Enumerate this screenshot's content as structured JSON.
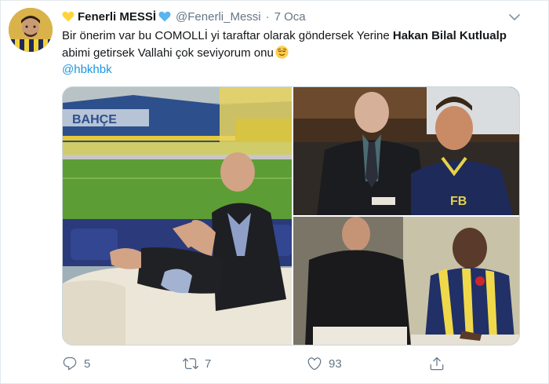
{
  "tweet": {
    "display_name": "Fenerli MESSİ",
    "handle": "@Fenerli_Messi",
    "separator": "·",
    "time": "7 Oca",
    "text_part1": "Bir önerim var bu COMOLLİ yi taraftar olarak göndersek Yerine ",
    "text_bold": "Hakan Bilal Kutlualp",
    "text_part2": " abimi getirsek Vallahi çok seviyorum onu",
    "emoji": "relieved-face-emoji",
    "mention": "@hbkhbk",
    "heart_color": "#ffd43b",
    "heart_color_after": "#5ab4ee"
  },
  "actions": {
    "replies": "5",
    "retweets": "7",
    "likes": "93"
  },
  "colors": {
    "link": "#1b95e0",
    "muted": "#657786",
    "text": "#14171a",
    "border": "#e1e8ed"
  },
  "media": {
    "photos": [
      "stadium-interview-photo",
      "contract-signing-photo",
      "jersey-signing-photo"
    ]
  }
}
